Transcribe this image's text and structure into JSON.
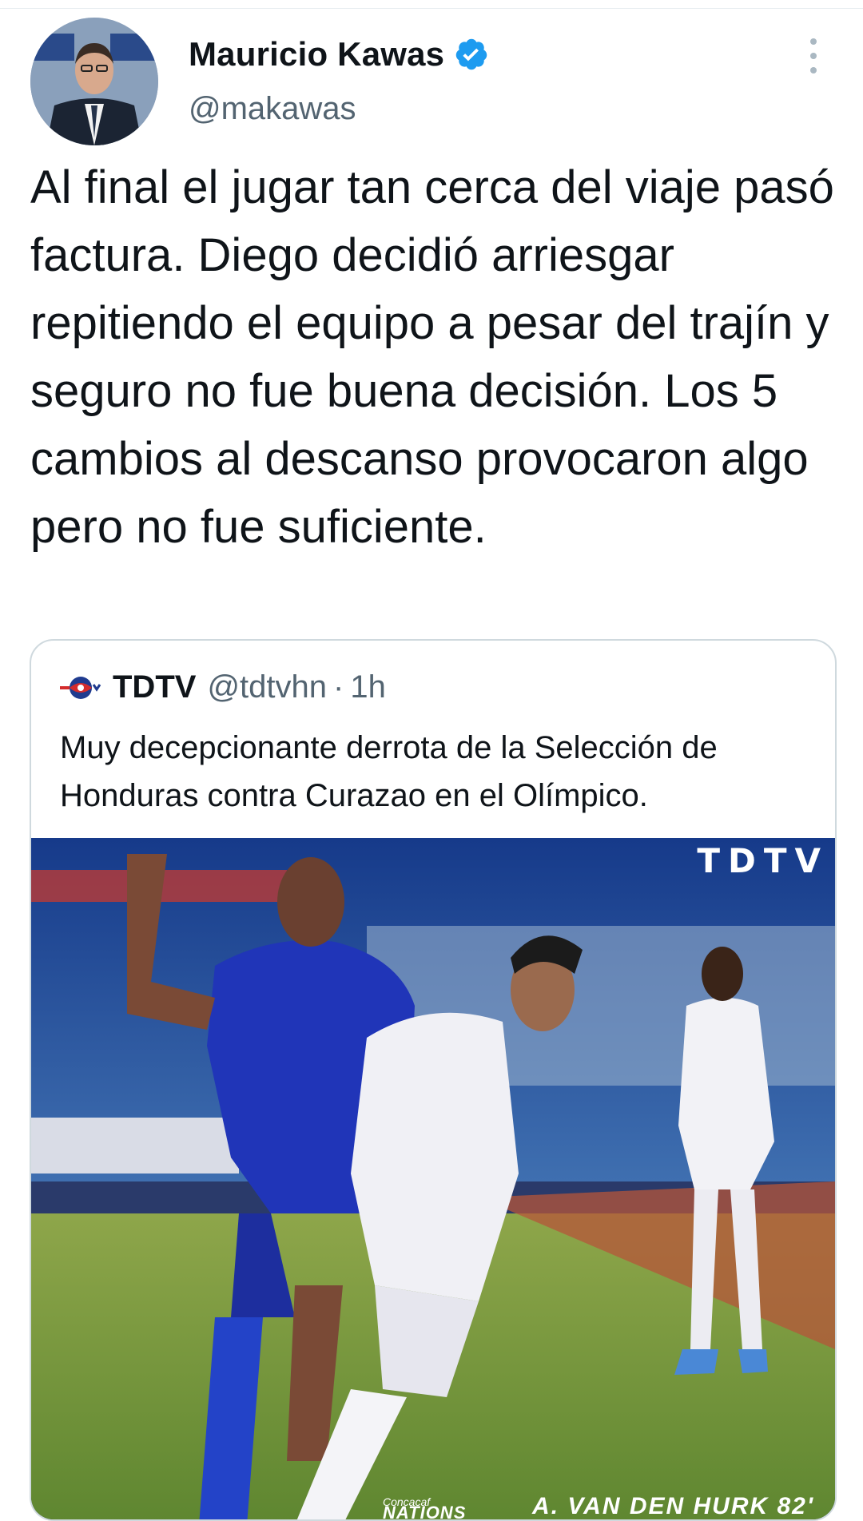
{
  "author": {
    "name": "Mauricio Kawas",
    "handle": "@makawas",
    "verified": true,
    "avatar_icon": "avatar"
  },
  "tweet": {
    "text": "Al final el jugar tan cerca del viaje pasó factura. Diego decidió arriesgar repitiendo el equipo a pesar del trajín y seguro no fue buena decisión. Los 5 cambios al descanso provocaron algo pero no fue suficiente."
  },
  "quoted": {
    "name": "TDTV",
    "handle": "@tdtvhn",
    "separator": "·",
    "time": "1h",
    "text": "Muy decepcionante derrota de la Selección de Honduras contra Curazao en el Olímpico.",
    "media": {
      "watermark": "TDTV",
      "caption": "A. VAN DEN HURK 82'",
      "league_line1": "Concacaf",
      "league_line2": "NATIONS"
    }
  },
  "colors": {
    "verified": "#1d9bf0",
    "text_primary": "#0f1419",
    "text_secondary": "#536471",
    "border": "#cfd9de"
  }
}
